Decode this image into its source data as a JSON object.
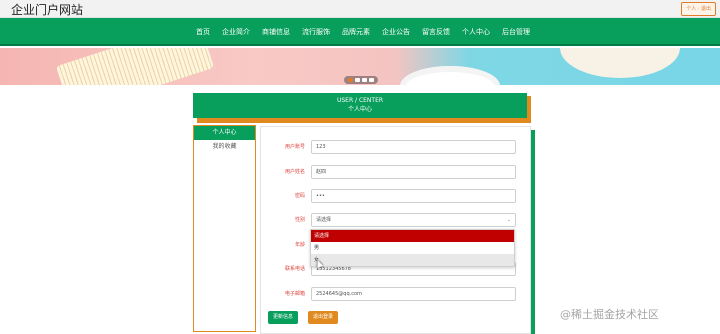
{
  "header": {
    "site_title": "企业门户网站",
    "user_box": "个人 · 退出"
  },
  "nav": {
    "items": [
      "首页",
      "企业简介",
      "商铺信息",
      "流行服饰",
      "品牌元素",
      "企业公告",
      "留言反馈",
      "个人中心",
      "后台管理"
    ]
  },
  "banner": {
    "dots": 4,
    "active_dot": 1
  },
  "center": {
    "title_en": "USER / CENTER",
    "title_zh": "个人中心"
  },
  "sidebar": {
    "items": [
      "个人中心",
      "我的收藏"
    ]
  },
  "form": {
    "fields": [
      {
        "label": "用户账号",
        "value": "123"
      },
      {
        "label": "用户姓名",
        "value": "赵四"
      },
      {
        "label": "密码",
        "value": "•••"
      },
      {
        "label": "性别",
        "value": "请选择"
      },
      {
        "label": "年龄",
        "value": ""
      },
      {
        "label": "联系电话",
        "value": "13512345678"
      },
      {
        "label": "电子邮箱",
        "value": "2524645@qq.com"
      }
    ],
    "gender_options": [
      "请选择",
      "男",
      "女"
    ],
    "update_button": "更新信息",
    "logout_button": "退出登录"
  },
  "watermark": "@稀土掘金技术社区",
  "colors": {
    "primary_green": "#089e5c",
    "accent_orange": "#e0891e",
    "selected_red": "#c00000"
  }
}
